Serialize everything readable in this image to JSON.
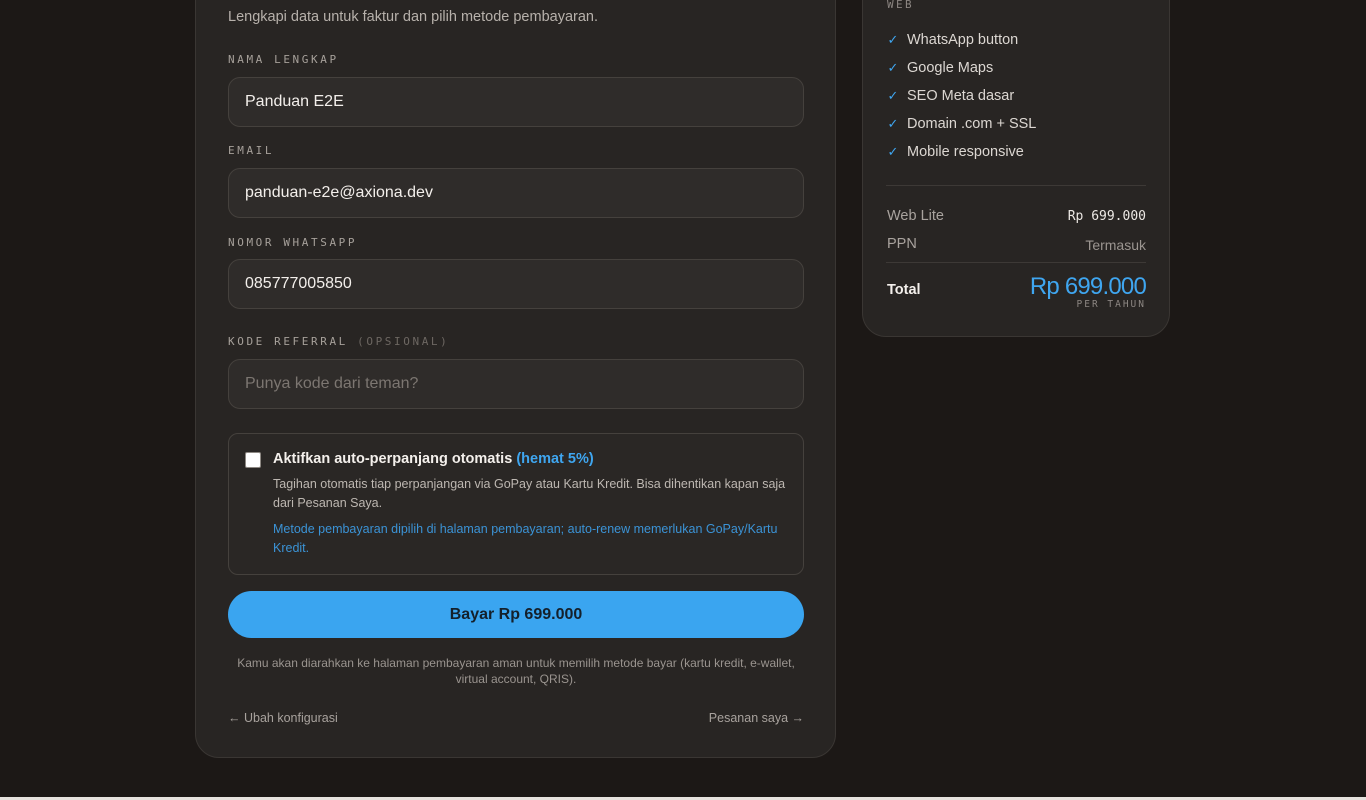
{
  "form": {
    "subtitle": "Lengkapi data untuk faktur dan pilih metode pembayaran.",
    "name_label": "NAMA LENGKAP",
    "name_value": "Panduan E2E",
    "email_label": "EMAIL",
    "email_value": "panduan-e2e@axiona.dev",
    "whatsapp_label": "NOMOR WHATSAPP",
    "whatsapp_value": "085777005850",
    "referral_label": "KODE REFERRAL",
    "referral_optional": "(OPSIONAL)",
    "referral_value": "",
    "referral_placeholder": "Punya kode dari teman?",
    "auto_renew": {
      "checked": false,
      "title": "Aktifkan auto-perpanjang otomatis",
      "save_badge": "(hemat 5%)",
      "description": "Tagihan otomatis tiap perpanjangan via GoPay atau Kartu Kredit. Bisa dihentikan kapan saja dari Pesanan Saya.",
      "note": "Metode pembayaran dipilih di halaman pembayaran; auto-renew memerlukan GoPay/Kartu Kredit."
    },
    "pay_button_label": "Bayar Rp 699.000",
    "redirect_note": "Kamu akan diarahkan ke halaman pembayaran aman untuk memilih metode bayar (kartu kredit, e-wallet, virtual account, QRIS).",
    "back_link": "← Ubah konfigurasi",
    "orders_link": "Pesanan saya →"
  },
  "summary": {
    "section_label": "WEB",
    "features": [
      {
        "icon": "check-icon",
        "text": "WhatsApp button"
      },
      {
        "icon": "check-icon",
        "text": "Google Maps"
      },
      {
        "icon": "check-icon",
        "text": "SEO Meta dasar"
      },
      {
        "icon": "check-icon",
        "text": "Domain .com + SSL"
      },
      {
        "icon": "check-icon",
        "text": "Mobile responsive"
      }
    ],
    "plan_label": "Web Lite",
    "plan_price": "Rp 699.000",
    "tax_label": "PPN",
    "tax_value": "Termasuk",
    "total_label": "Total",
    "total_value": "Rp 699.000",
    "total_period": "PER TAHUN"
  },
  "colors": {
    "background": "#1c1816",
    "card": "#282523",
    "accent": "#3aa5f0"
  }
}
